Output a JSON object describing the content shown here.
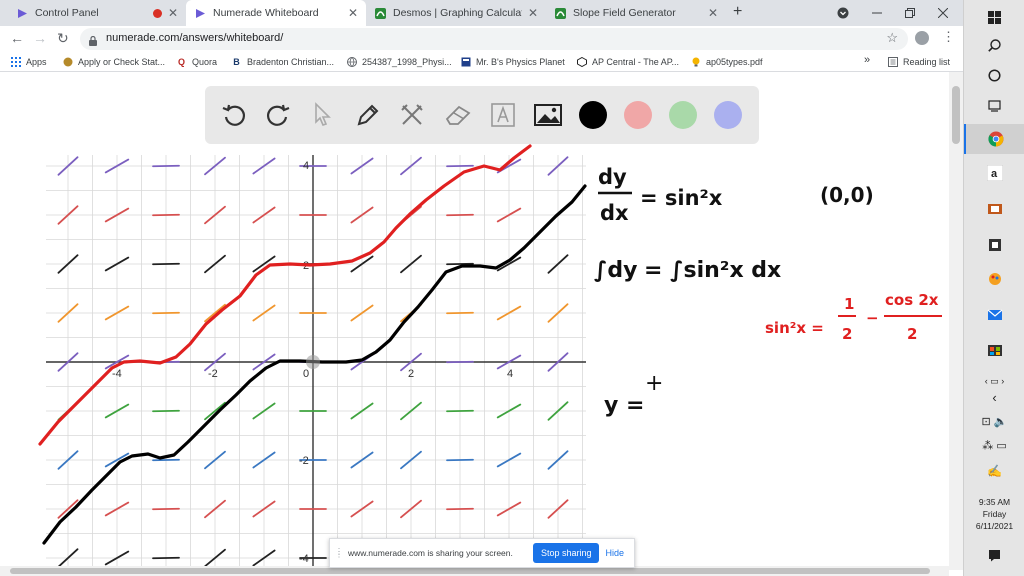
{
  "browser": {
    "tabs": [
      {
        "title": "Control Panel",
        "recording": true
      },
      {
        "title": "Numerade Whiteboard",
        "recording": false
      },
      {
        "title": "Desmos | Graphing Calculator",
        "recording": false
      },
      {
        "title": "Slope Field Generator",
        "recording": false
      }
    ],
    "active_tab": 1,
    "url": "numerade.com/answers/whiteboard/",
    "bookmarks": [
      "Apps",
      "Apply or Check Stat...",
      "Quora",
      "Bradenton Christian...",
      "254387_1998_Physi...",
      "Mr. B's Physics Planet",
      "AP Central - The AP...",
      "ap05types.pdf"
    ],
    "bookmarks_overflow": "»",
    "reading_list": "Reading list",
    "new_tab": "+"
  },
  "whiteboard": {
    "tools": [
      "undo-icon",
      "redo-icon",
      "pointer-icon",
      "pen-icon",
      "tools-icon",
      "eraser-icon",
      "text-icon",
      "image-icon"
    ],
    "colors": [
      "#000000",
      "#f0a7a7",
      "#a9d9a9",
      "#aab0ef"
    ],
    "selected_color": "#000000",
    "graph": {
      "x_ticks": [
        "-4",
        "-2",
        "0",
        "2",
        "4"
      ],
      "y_ticks": [
        "4",
        "2",
        "-2",
        "-4"
      ]
    },
    "notes": {
      "dy": "dy",
      "dx": "dx",
      "eq1_rhs": "= sin²x",
      "point": "(0,0)",
      "integral_lhs": "∫dy",
      "integral_rhs": "= ∫sin²x  dx",
      "identity_lhs": "sin²x =",
      "identity_a_num": "1",
      "identity_a_den": "2",
      "identity_minus": "−",
      "identity_b_num": "cos 2x",
      "identity_b_den": "2",
      "answer": "y =",
      "answer_plus": "+"
    }
  },
  "share_banner": {
    "message": "www.numerade.com is sharing your screen.",
    "stop": "Stop sharing",
    "hide": "Hide"
  },
  "taskbar": {
    "time": "9:35 AM",
    "day": "Friday",
    "date": "6/11/2021"
  }
}
